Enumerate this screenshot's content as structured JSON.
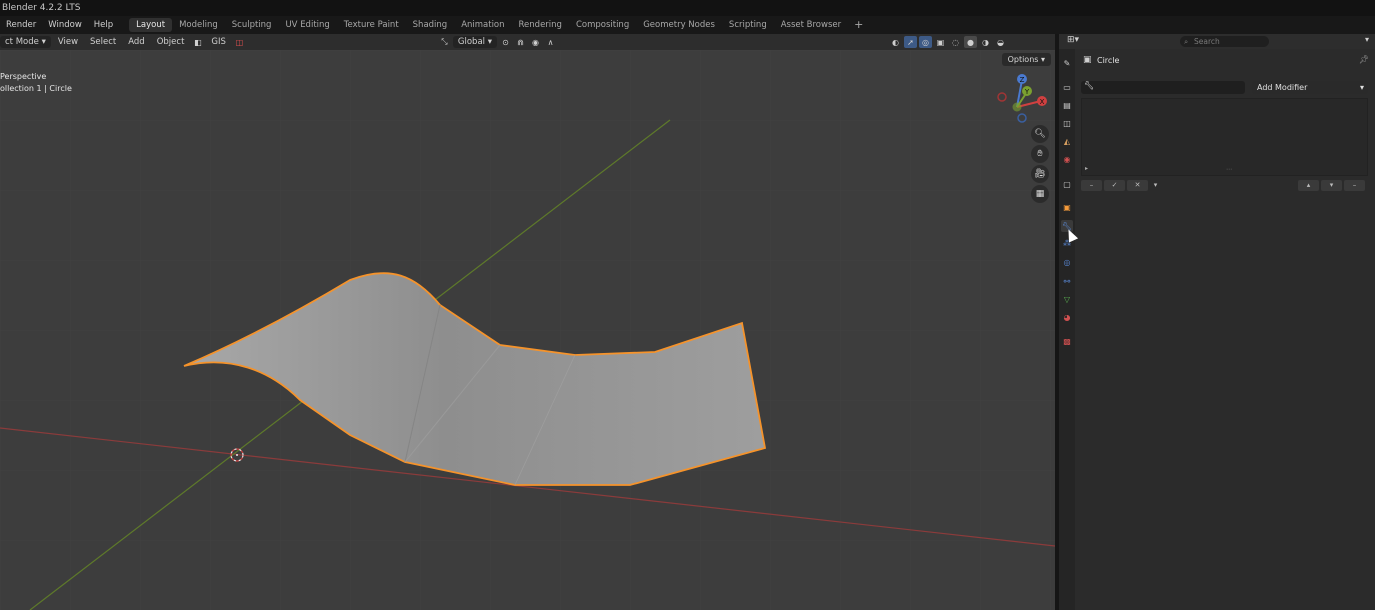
{
  "app": {
    "title": "Blender 4.2.2 LTS"
  },
  "topbar": {
    "menus": [
      "Render",
      "Window",
      "Help"
    ],
    "workspaces": [
      "Layout",
      "Modeling",
      "Sculpting",
      "UV Editing",
      "Texture Paint",
      "Shading",
      "Animation",
      "Rendering",
      "Compositing",
      "Geometry Nodes",
      "Scripting",
      "Asset Browser"
    ],
    "active_workspace": "Layout",
    "add_tab": "+"
  },
  "viewport": {
    "mode": "ct Mode",
    "menus": [
      "View",
      "Select",
      "Add",
      "Object"
    ],
    "gis": "GIS",
    "transform_orientation": "Global",
    "overlay_line1": "Perspective",
    "overlay_line2": "ollection 1 | Circle",
    "options_label": "Options",
    "gizmo_axes": {
      "x": "X",
      "y": "Y",
      "z": "Z"
    },
    "colors": {
      "selection": "#f5932b",
      "x_axis": "#8b3b3b",
      "y_axis": "#5e7a2a",
      "background": "#3d3d3d",
      "surface": "#9a9a9a"
    }
  },
  "properties": {
    "search_placeholder": "Search",
    "object_name": "Circle",
    "add_modifier_label": "Add Modifier",
    "icons": [
      "tool-icon",
      "render-icon",
      "output-icon",
      "view-layer-icon",
      "scene-icon",
      "world-icon",
      "collection-icon",
      "object-icon",
      "modifier-icon",
      "particles-icon",
      "physics-icon",
      "constraints-icon",
      "data-icon",
      "material-icon",
      "texture-icon"
    ]
  }
}
